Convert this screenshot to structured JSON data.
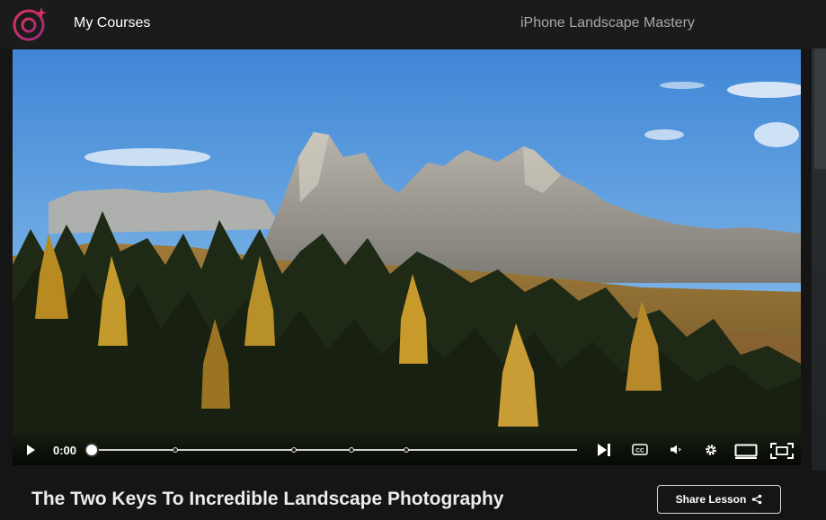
{
  "header": {
    "nav_label": "My Courses",
    "course_title": "iPhone Landscape Mastery"
  },
  "player": {
    "current_time": "0:00",
    "progress": 0,
    "chapter_markers": 4
  },
  "lesson": {
    "title": "The Two Keys To Incredible Landscape Photography",
    "share_label": "Share Lesson"
  },
  "icons": {
    "logo": "camera-lens-sparkle-logo",
    "play": "play-icon",
    "next": "skip-next-icon",
    "captions": "closed-captions-icon",
    "volume": "volume-icon",
    "settings": "gear-icon",
    "theater": "theater-mode-icon",
    "fullscreen": "fullscreen-icon",
    "share": "share-icon"
  },
  "colors": {
    "accent_logo": "#d6336c",
    "background": "#151515"
  }
}
